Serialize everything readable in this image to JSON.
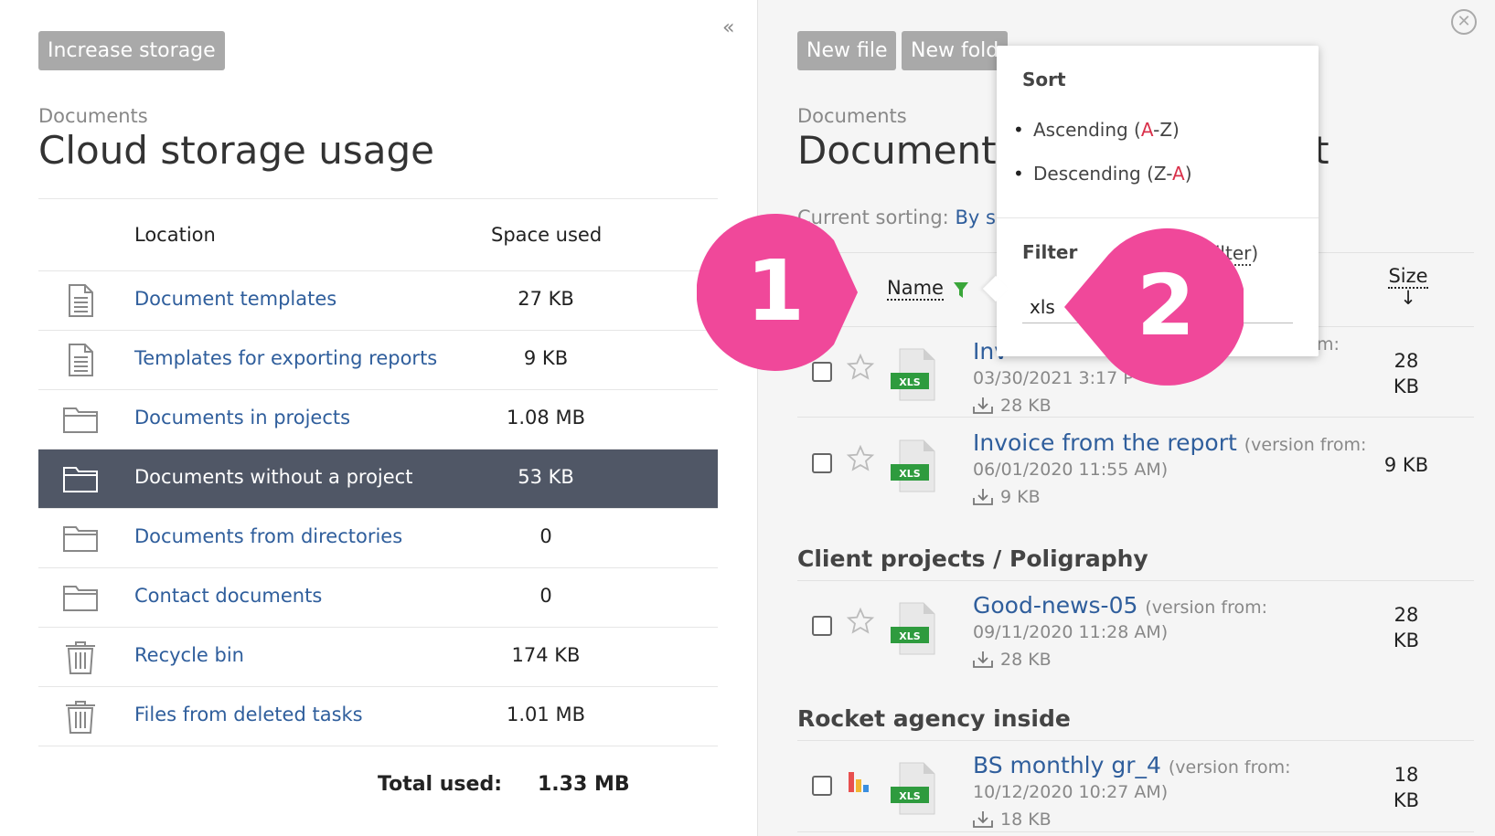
{
  "left": {
    "increase_btn": "Increase storage",
    "breadcrumb": "Documents",
    "title": "Cloud storage usage",
    "col_location": "Location",
    "col_space": "Space used",
    "rows": [
      {
        "label": "Document templates",
        "value": "27 KB",
        "icon": "document-icon"
      },
      {
        "label": "Templates for exporting reports",
        "value": "9 KB",
        "icon": "document-icon"
      },
      {
        "label": "Documents in projects",
        "value": "1.08 MB",
        "icon": "folder-icon"
      },
      {
        "label": "Documents without a project",
        "value": "53 KB",
        "icon": "folder-icon"
      },
      {
        "label": "Documents from directories",
        "value": "0",
        "icon": "folder-icon"
      },
      {
        "label": "Contact documents",
        "value": "0",
        "icon": "folder-icon"
      },
      {
        "label": "Recycle bin",
        "value": "174 KB",
        "icon": "trash-icon"
      },
      {
        "label": "Files from deleted tasks",
        "value": "1.01 MB",
        "icon": "trash-icon"
      }
    ],
    "total_label": "Total used:",
    "total_value": "1.33 MB"
  },
  "right": {
    "new_file_btn": "New file",
    "new_folder_btn": "New fold",
    "breadcrumb": "Documents",
    "title_left": "Documents",
    "title_right": "ct",
    "sorting_label": "Current sorting:",
    "sorting_value": "By s",
    "col_name": "Name",
    "col_size": "Size",
    "size_arrow": "↓",
    "files": [
      {
        "name": "Inv",
        "version": "",
        "date": "03/30/2021 3:17 P",
        "download": "28 KB",
        "size_line1": "28",
        "size_line2": "KB",
        "trailing": "m:"
      },
      {
        "name": "Invoice from the report",
        "version": "(version from:",
        "date": "06/01/2020 11:55 AM)",
        "download": "9 KB",
        "size_line1": "9 KB",
        "size_line2": ""
      }
    ],
    "group1": "Client projects / Poligraphy",
    "files2": [
      {
        "name": "Good-news-05",
        "version": "(version from:",
        "date": "09/11/2020 11:28 AM)",
        "download": "28 KB",
        "size_line1": "28",
        "size_line2": "KB"
      }
    ],
    "group2": "Rocket agency inside",
    "files3": [
      {
        "name": "BS monthly gr_4",
        "version": "(version from:",
        "date": "10/12/2020 10:27 AM)",
        "download": "18 KB",
        "size_line1": "18",
        "size_line2": "KB"
      }
    ],
    "xls_label": "XLS"
  },
  "popup": {
    "sort_heading": "Sort",
    "asc_prefix": "Ascending (",
    "asc_a": "A",
    "asc_mid": "-Z)",
    "desc_prefix": "Descending (Z-",
    "desc_a": "A",
    "desc_suffix": ")",
    "filter_heading": "Filter",
    "clear_text": "ar filter",
    "clear_close": ")",
    "filter_value": "xls"
  },
  "callouts": {
    "one": "1",
    "two": "2"
  },
  "colors": {
    "accent": "#2f5e9c",
    "selected_row": "#505766",
    "callout": "#f0489a",
    "funnel": "#3aa63a",
    "xls_green": "#2e9b3e"
  }
}
